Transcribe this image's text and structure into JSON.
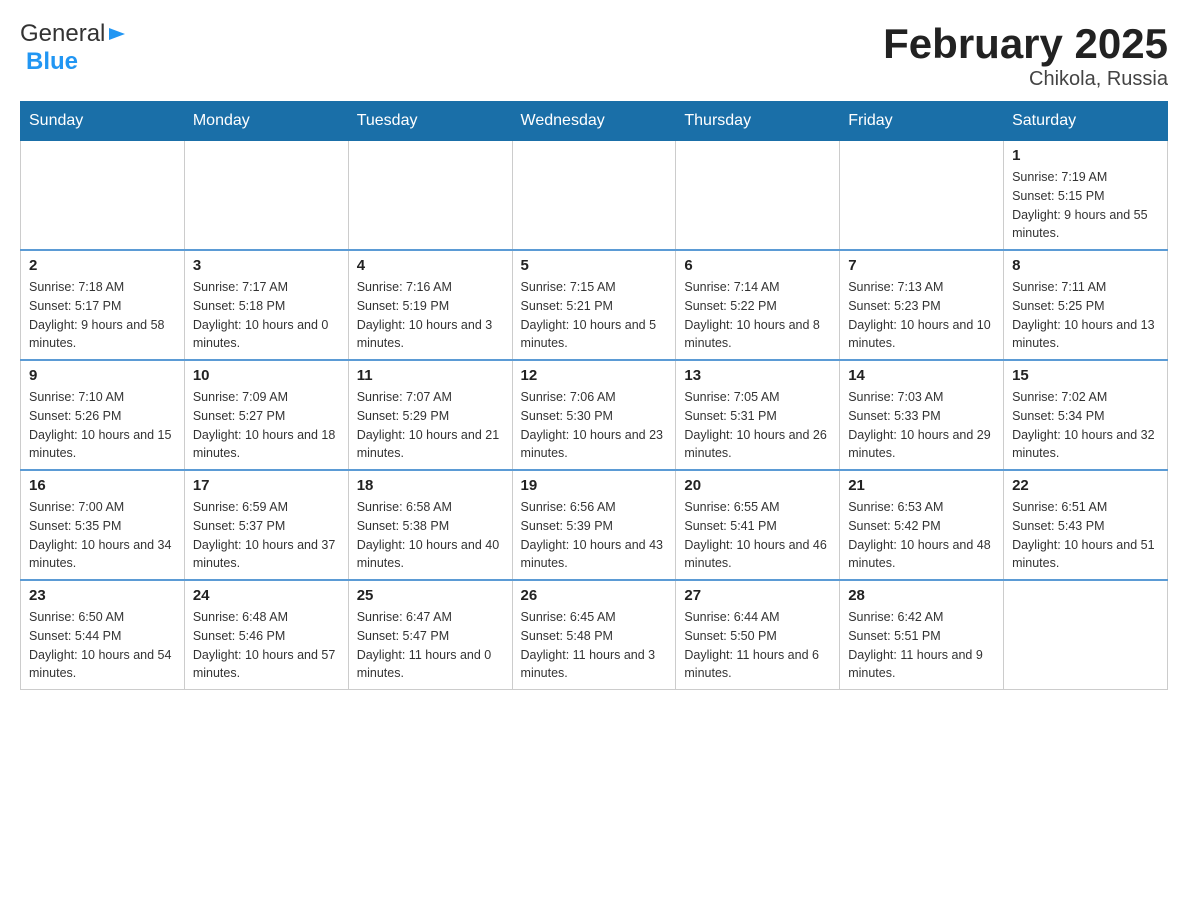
{
  "header": {
    "logo_general": "General",
    "logo_blue": "Blue",
    "month_title": "February 2025",
    "location": "Chikola, Russia"
  },
  "days_of_week": [
    "Sunday",
    "Monday",
    "Tuesday",
    "Wednesday",
    "Thursday",
    "Friday",
    "Saturday"
  ],
  "weeks": [
    [
      {
        "day": "",
        "sunrise": "",
        "sunset": "",
        "daylight": ""
      },
      {
        "day": "",
        "sunrise": "",
        "sunset": "",
        "daylight": ""
      },
      {
        "day": "",
        "sunrise": "",
        "sunset": "",
        "daylight": ""
      },
      {
        "day": "",
        "sunrise": "",
        "sunset": "",
        "daylight": ""
      },
      {
        "day": "",
        "sunrise": "",
        "sunset": "",
        "daylight": ""
      },
      {
        "day": "",
        "sunrise": "",
        "sunset": "",
        "daylight": ""
      },
      {
        "day": "1",
        "sunrise": "Sunrise: 7:19 AM",
        "sunset": "Sunset: 5:15 PM",
        "daylight": "Daylight: 9 hours and 55 minutes."
      }
    ],
    [
      {
        "day": "2",
        "sunrise": "Sunrise: 7:18 AM",
        "sunset": "Sunset: 5:17 PM",
        "daylight": "Daylight: 9 hours and 58 minutes."
      },
      {
        "day": "3",
        "sunrise": "Sunrise: 7:17 AM",
        "sunset": "Sunset: 5:18 PM",
        "daylight": "Daylight: 10 hours and 0 minutes."
      },
      {
        "day": "4",
        "sunrise": "Sunrise: 7:16 AM",
        "sunset": "Sunset: 5:19 PM",
        "daylight": "Daylight: 10 hours and 3 minutes."
      },
      {
        "day": "5",
        "sunrise": "Sunrise: 7:15 AM",
        "sunset": "Sunset: 5:21 PM",
        "daylight": "Daylight: 10 hours and 5 minutes."
      },
      {
        "day": "6",
        "sunrise": "Sunrise: 7:14 AM",
        "sunset": "Sunset: 5:22 PM",
        "daylight": "Daylight: 10 hours and 8 minutes."
      },
      {
        "day": "7",
        "sunrise": "Sunrise: 7:13 AM",
        "sunset": "Sunset: 5:23 PM",
        "daylight": "Daylight: 10 hours and 10 minutes."
      },
      {
        "day": "8",
        "sunrise": "Sunrise: 7:11 AM",
        "sunset": "Sunset: 5:25 PM",
        "daylight": "Daylight: 10 hours and 13 minutes."
      }
    ],
    [
      {
        "day": "9",
        "sunrise": "Sunrise: 7:10 AM",
        "sunset": "Sunset: 5:26 PM",
        "daylight": "Daylight: 10 hours and 15 minutes."
      },
      {
        "day": "10",
        "sunrise": "Sunrise: 7:09 AM",
        "sunset": "Sunset: 5:27 PM",
        "daylight": "Daylight: 10 hours and 18 minutes."
      },
      {
        "day": "11",
        "sunrise": "Sunrise: 7:07 AM",
        "sunset": "Sunset: 5:29 PM",
        "daylight": "Daylight: 10 hours and 21 minutes."
      },
      {
        "day": "12",
        "sunrise": "Sunrise: 7:06 AM",
        "sunset": "Sunset: 5:30 PM",
        "daylight": "Daylight: 10 hours and 23 minutes."
      },
      {
        "day": "13",
        "sunrise": "Sunrise: 7:05 AM",
        "sunset": "Sunset: 5:31 PM",
        "daylight": "Daylight: 10 hours and 26 minutes."
      },
      {
        "day": "14",
        "sunrise": "Sunrise: 7:03 AM",
        "sunset": "Sunset: 5:33 PM",
        "daylight": "Daylight: 10 hours and 29 minutes."
      },
      {
        "day": "15",
        "sunrise": "Sunrise: 7:02 AM",
        "sunset": "Sunset: 5:34 PM",
        "daylight": "Daylight: 10 hours and 32 minutes."
      }
    ],
    [
      {
        "day": "16",
        "sunrise": "Sunrise: 7:00 AM",
        "sunset": "Sunset: 5:35 PM",
        "daylight": "Daylight: 10 hours and 34 minutes."
      },
      {
        "day": "17",
        "sunrise": "Sunrise: 6:59 AM",
        "sunset": "Sunset: 5:37 PM",
        "daylight": "Daylight: 10 hours and 37 minutes."
      },
      {
        "day": "18",
        "sunrise": "Sunrise: 6:58 AM",
        "sunset": "Sunset: 5:38 PM",
        "daylight": "Daylight: 10 hours and 40 minutes."
      },
      {
        "day": "19",
        "sunrise": "Sunrise: 6:56 AM",
        "sunset": "Sunset: 5:39 PM",
        "daylight": "Daylight: 10 hours and 43 minutes."
      },
      {
        "day": "20",
        "sunrise": "Sunrise: 6:55 AM",
        "sunset": "Sunset: 5:41 PM",
        "daylight": "Daylight: 10 hours and 46 minutes."
      },
      {
        "day": "21",
        "sunrise": "Sunrise: 6:53 AM",
        "sunset": "Sunset: 5:42 PM",
        "daylight": "Daylight: 10 hours and 48 minutes."
      },
      {
        "day": "22",
        "sunrise": "Sunrise: 6:51 AM",
        "sunset": "Sunset: 5:43 PM",
        "daylight": "Daylight: 10 hours and 51 minutes."
      }
    ],
    [
      {
        "day": "23",
        "sunrise": "Sunrise: 6:50 AM",
        "sunset": "Sunset: 5:44 PM",
        "daylight": "Daylight: 10 hours and 54 minutes."
      },
      {
        "day": "24",
        "sunrise": "Sunrise: 6:48 AM",
        "sunset": "Sunset: 5:46 PM",
        "daylight": "Daylight: 10 hours and 57 minutes."
      },
      {
        "day": "25",
        "sunrise": "Sunrise: 6:47 AM",
        "sunset": "Sunset: 5:47 PM",
        "daylight": "Daylight: 11 hours and 0 minutes."
      },
      {
        "day": "26",
        "sunrise": "Sunrise: 6:45 AM",
        "sunset": "Sunset: 5:48 PM",
        "daylight": "Daylight: 11 hours and 3 minutes."
      },
      {
        "day": "27",
        "sunrise": "Sunrise: 6:44 AM",
        "sunset": "Sunset: 5:50 PM",
        "daylight": "Daylight: 11 hours and 6 minutes."
      },
      {
        "day": "28",
        "sunrise": "Sunrise: 6:42 AM",
        "sunset": "Sunset: 5:51 PM",
        "daylight": "Daylight: 11 hours and 9 minutes."
      },
      {
        "day": "",
        "sunrise": "",
        "sunset": "",
        "daylight": ""
      }
    ]
  ]
}
